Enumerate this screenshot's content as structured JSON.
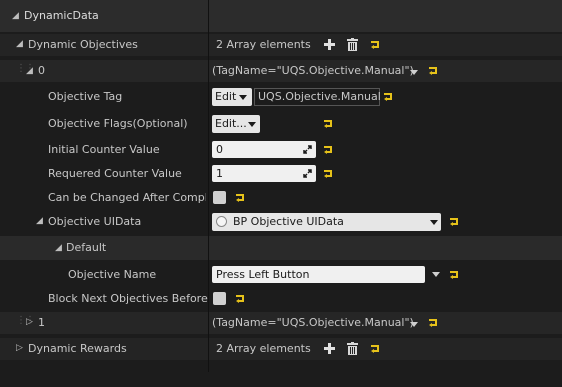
{
  "category": {
    "title": "DynamicData"
  },
  "dynamic_objectives": {
    "label": "Dynamic Objectives",
    "summary": "2 Array elements",
    "element0": {
      "index": "0",
      "value": "(TagName=\"UQS.Objective.Manual\")",
      "objective_tag": {
        "label": "Objective Tag",
        "edit_label": "Edit",
        "value": "UQS.Objective.Manual"
      },
      "objective_flags": {
        "label": "Objective Flags(Optional)",
        "edit_label": "Edit..."
      },
      "initial_counter": {
        "label": "Initial Counter Value",
        "value": "0"
      },
      "required_counter": {
        "label": "Requered Counter Value",
        "value": "1"
      },
      "can_change": {
        "label": "Can be Changed After Complete"
      },
      "ui_data": {
        "label": "Objective UIData",
        "value": "BP Objective UIData",
        "default": {
          "label": "Default",
          "objective_name": {
            "label": "Objective Name",
            "value": "Press Left Button"
          }
        }
      },
      "block_next": {
        "label": "Block Next Objectives Before Co"
      }
    },
    "element1": {
      "index": "1",
      "value": "(TagName=\"UQS.Objective.Manual\")"
    }
  },
  "dynamic_rewards": {
    "label": "Dynamic Rewards",
    "summary": "2 Array elements"
  },
  "colors": {
    "accent_yellow": "#e6c21a",
    "field_bg": "#f0f0f0",
    "panel_bg": "#1c1c1c"
  }
}
